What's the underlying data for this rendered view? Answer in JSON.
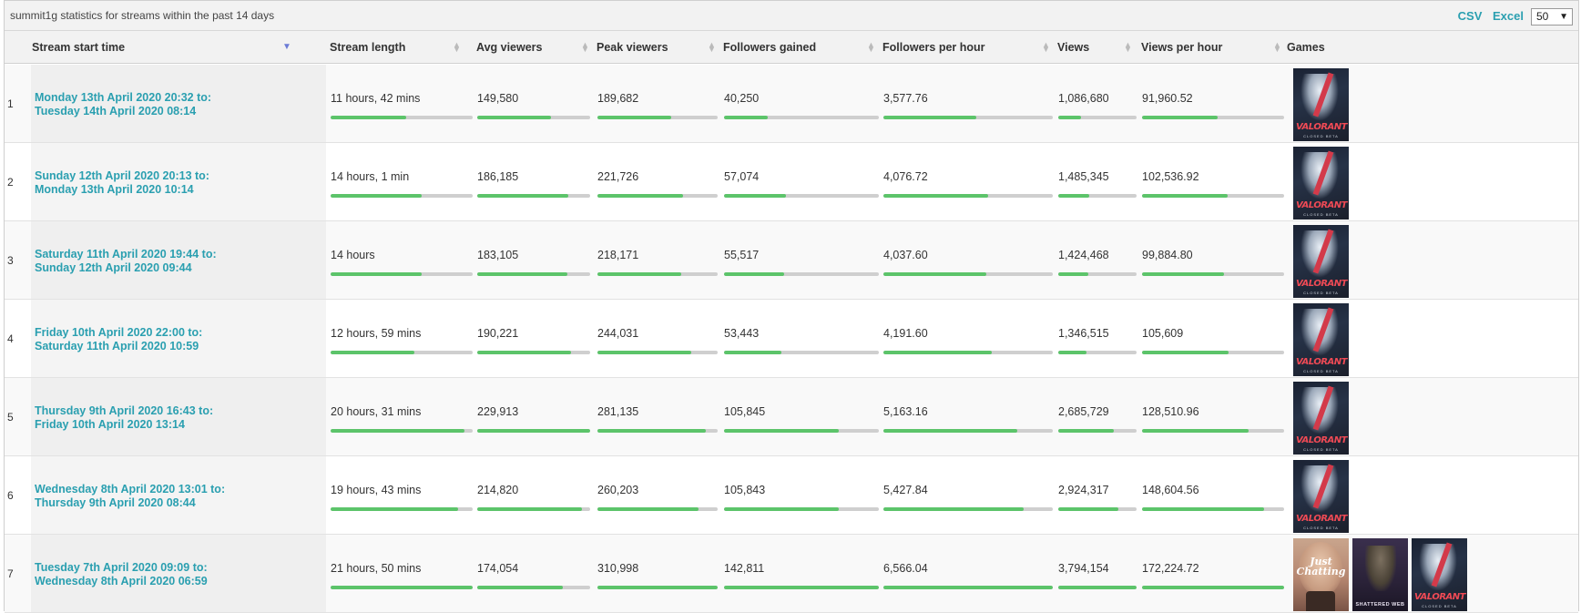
{
  "caption": "summit1g statistics for streams within the past 14 days",
  "exports": {
    "csv": "CSV",
    "excel": "Excel"
  },
  "page_size": {
    "value": "50"
  },
  "columns": {
    "start": "Stream start time",
    "length": "Stream length",
    "avg": "Avg viewers",
    "peak": "Peak viewers",
    "fg": "Followers gained",
    "fph": "Followers per hour",
    "views": "Views",
    "vph": "Views per hour",
    "games": "Games"
  },
  "colors": {
    "accent": "#2a9fb0",
    "bar_fill": "#5cc46a",
    "bar_track": "#cfcfcf"
  },
  "rows": [
    {
      "rank": "1",
      "start_line1": "Monday 13th April 2020 20:32 to:",
      "start_line2": "Tuesday 14th April 2020 08:14",
      "length": "11 hours, 42 mins",
      "avg": "149,580",
      "peak": "189,682",
      "fg": "40,250",
      "fph": "3,577.76",
      "views": "1,086,680",
      "vph": "91,960.52",
      "bars": {
        "length": 0.53,
        "avg": 0.65,
        "peak": 0.61,
        "fg": 0.28,
        "fph": 0.55,
        "views": 0.29,
        "vph": 0.53
      },
      "games": [
        "valorant-cover"
      ]
    },
    {
      "rank": "2",
      "start_line1": "Sunday 12th April 2020 20:13 to:",
      "start_line2": "Monday 13th April 2020 10:14",
      "length": "14 hours, 1 min",
      "avg": "186,185",
      "peak": "221,726",
      "fg": "57,074",
      "fph": "4,076.72",
      "views": "1,485,345",
      "vph": "102,536.92",
      "bars": {
        "length": 0.64,
        "avg": 0.81,
        "peak": 0.71,
        "fg": 0.4,
        "fph": 0.62,
        "views": 0.39,
        "vph": 0.6
      },
      "games": [
        "valorant-cover"
      ]
    },
    {
      "rank": "3",
      "start_line1": "Saturday 11th April 2020 19:44 to:",
      "start_line2": "Sunday 12th April 2020 09:44",
      "length": "14 hours",
      "avg": "183,105",
      "peak": "218,171",
      "fg": "55,517",
      "fph": "4,037.60",
      "views": "1,424,468",
      "vph": "99,884.80",
      "bars": {
        "length": 0.64,
        "avg": 0.8,
        "peak": 0.7,
        "fg": 0.39,
        "fph": 0.61,
        "views": 0.38,
        "vph": 0.58
      },
      "games": [
        "valorant-cover"
      ]
    },
    {
      "rank": "4",
      "start_line1": "Friday 10th April 2020 22:00 to:",
      "start_line2": "Saturday 11th April 2020 10:59",
      "length": "12 hours, 59 mins",
      "avg": "190,221",
      "peak": "244,031",
      "fg": "53,443",
      "fph": "4,191.60",
      "views": "1,346,515",
      "vph": "105,609",
      "bars": {
        "length": 0.59,
        "avg": 0.83,
        "peak": 0.78,
        "fg": 0.37,
        "fph": 0.64,
        "views": 0.36,
        "vph": 0.61
      },
      "games": [
        "valorant-cover"
      ]
    },
    {
      "rank": "5",
      "start_line1": "Thursday 9th April 2020 16:43 to:",
      "start_line2": "Friday 10th April 2020 13:14",
      "length": "20 hours, 31 mins",
      "avg": "229,913",
      "peak": "281,135",
      "fg": "105,845",
      "fph": "5,163.16",
      "views": "2,685,729",
      "vph": "128,510.96",
      "bars": {
        "length": 0.94,
        "avg": 1.0,
        "peak": 0.9,
        "fg": 0.74,
        "fph": 0.79,
        "views": 0.71,
        "vph": 0.75
      },
      "games": [
        "valorant-cover"
      ]
    },
    {
      "rank": "6",
      "start_line1": "Wednesday 8th April 2020 13:01 to:",
      "start_line2": "Thursday 9th April 2020 08:44",
      "length": "19 hours, 43 mins",
      "avg": "214,820",
      "peak": "260,203",
      "fg": "105,843",
      "fph": "5,427.84",
      "views": "2,924,317",
      "vph": "148,604.56",
      "bars": {
        "length": 0.9,
        "avg": 0.93,
        "peak": 0.84,
        "fg": 0.74,
        "fph": 0.83,
        "views": 0.77,
        "vph": 0.86
      },
      "games": [
        "valorant-cover"
      ]
    },
    {
      "rank": "7",
      "start_line1": "Tuesday 7th April 2020 09:09 to:",
      "start_line2": "Wednesday 8th April 2020 06:59",
      "length": "21 hours, 50 mins",
      "avg": "174,054",
      "peak": "310,998",
      "fg": "142,811",
      "fph": "6,566.04",
      "views": "3,794,154",
      "vph": "172,224.72",
      "bars": {
        "length": 1.0,
        "avg": 0.76,
        "peak": 1.0,
        "fg": 1.0,
        "fph": 1.0,
        "views": 1.0,
        "vph": 1.0
      },
      "games": [
        "just-chatting-cover",
        "rainbow-six-siege-cover",
        "valorant-cover"
      ]
    }
  ],
  "game_art": {
    "valorant": {
      "logo": "VALORANT",
      "sub": "CLOSED BETA"
    },
    "chat": {
      "logo_line1": "Just",
      "logo_line2": "Chatting"
    },
    "r6": {
      "logo": "SHATTERED WEB"
    }
  }
}
